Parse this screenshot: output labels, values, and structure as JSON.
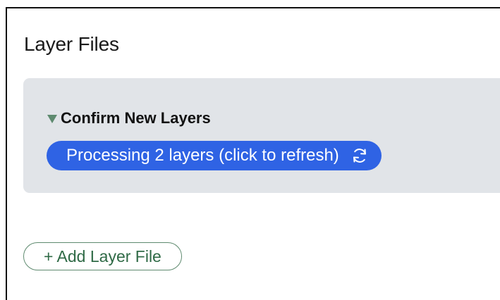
{
  "page": {
    "title": "Layer Files"
  },
  "confirm_section": {
    "label": "Confirm New Layers",
    "expanded": true,
    "status": {
      "text": "Processing 2 layers (click to refresh)",
      "icon": "refresh-icon",
      "color": "#2f63e4"
    }
  },
  "actions": {
    "add_layer_file_label": "+ Add Layer File"
  },
  "colors": {
    "accent_green": "#5e8a6f",
    "panel_background": "#e1e4e8",
    "status_blue": "#2f63e4"
  }
}
